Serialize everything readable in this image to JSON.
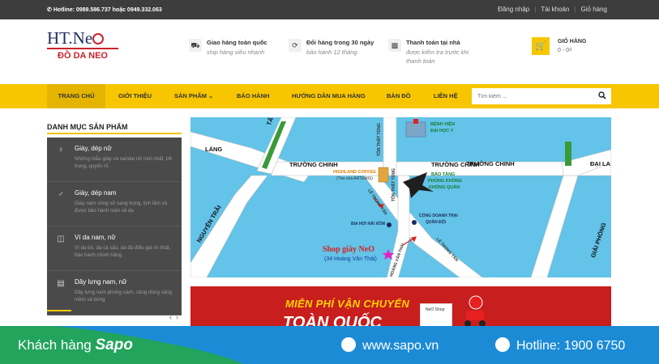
{
  "topbar": {
    "hotline": "Hotline: 0989.586.737 hoặc 0949.332.063",
    "links": [
      "Đăng nhập",
      "Tài khoản",
      "Giỏ hàng"
    ]
  },
  "logo": {
    "top": "HT.Ne",
    "bottom": "ĐỒ DA NEO"
  },
  "features": [
    {
      "title": "Giao hàng toàn quốc",
      "subtitle": "ship hàng siêu nhanh",
      "icon": "truck-icon"
    },
    {
      "title": "Đổi hàng trong 30 ngày",
      "subtitle": "bảo hành 12 tháng",
      "icon": "refresh-icon"
    },
    {
      "title": "Thanh toán tại nhà",
      "subtitle": "được kiểm tra trước khi thanh toán",
      "icon": "money-icon"
    }
  ],
  "cart": {
    "title": "GIỎ HÀNG",
    "value": "0 - 0₫"
  },
  "nav": {
    "items": [
      "Trang chủ",
      "Giới thiệu",
      "Sản phẩm",
      "Bảo hành",
      "Hướng dẫn mua hàng",
      "Bản đồ",
      "Liên hệ"
    ],
    "active": "Trang chủ",
    "search_placeholder": "Tìm kiếm ..."
  },
  "sidebar": {
    "title": "DANH MỤC SẢN PHẨM",
    "items": [
      {
        "title": "Giày, dép nữ",
        "desc": "Những mẫu giày và sandal nữ mới nhất, trẻ trung, quyến rũ",
        "icon": "female-icon"
      },
      {
        "title": "Giày, dép nam",
        "desc": "Giày nam công sở sang trọng, lịch lãm và được bảo hành toàn về da",
        "icon": "male-icon"
      },
      {
        "title": "Ví da nam, nữ",
        "desc": "Ví da bò, da cá sấu, da đà điểu giá rẻ nhất, bảo hành chính hãng",
        "icon": "briefcase-icon"
      },
      {
        "title": "Dây lưng nam, nữ",
        "desc": "Dây lưng nam phong cách, cảng dùng càng mềm và bóng",
        "icon": "belt-icon"
      }
    ]
  },
  "map": {
    "streets": {
      "lang": "LÁNG",
      "tayson": "TÂY SƠN",
      "truongchinh1": "TRƯỜNG CHINH",
      "truongchinh2": "TRƯỜNG CHINH",
      "truongchinh3": "TRƯỜNG CHINH",
      "daila": "ĐẠI LA",
      "tonthattung1": "TÔN THẤT TÙNG",
      "tonthattung2": "TÔN THẤT TÙNG",
      "nguyentrai": "NGUYỄN TRÃI",
      "giaiphong": "GIẢI PHÓNG",
      "letrongtan1": "LÊ TRỌNG TẤN",
      "letrongtan2": "LÊ TRỌNG TẤN",
      "hoangvanthai": "HOÀNG VĂN THÁI"
    },
    "places": {
      "hospital1": "BỆNH VIỆN",
      "hospital2": "ĐẠI HỌC Y",
      "highland1": "HIGHLAND COFFEE",
      "highland2": "(Tòa nhà ARTEMIS)",
      "museum1": "BẢO TÀNG",
      "museum2": "PHÒNG KHÔNG",
      "museum3": "KHÔNG QUÂN",
      "bia": "BIA HƠI HẢI XỒM",
      "cong1": "CỔNG DOANH TRẠI",
      "cong2": "QUÂN ĐỘI"
    },
    "shop_name": "Shop giày NeO",
    "shop_addr": "(34 Hoàng Văn Thái)"
  },
  "banner": {
    "headline": "MIỄN PHÍ VẬN CHUYỂN",
    "big": "TOÀN QUỐC",
    "box": "NeO Shop"
  },
  "sapo": {
    "brand_prefix": "Khách hàng",
    "brand_name": "Sapo",
    "website": "www.sapo.vn",
    "hotline": "Hotline: 1900 6750"
  }
}
